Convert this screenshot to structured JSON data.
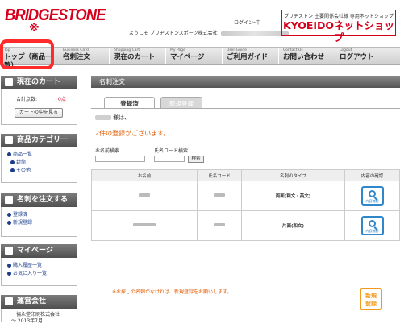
{
  "header": {
    "logo": "BRIDGESTONE",
    "logo_mark": "※",
    "login_label": "ログインｰ中",
    "welcome_prefix": "ようこそ ブリヂストンスポーツ株式会社",
    "shop_subtitle": "ブリヂストン 主要関係会社様 専用ネットショップ",
    "shop_name": "KYOEIDOネットショップ"
  },
  "nav": {
    "items": [
      {
        "en": "Top",
        "ja": "トップ（商品一覧）"
      },
      {
        "en": "Business Card",
        "ja": "名刺注文"
      },
      {
        "en": "Shopping Cart",
        "ja": "現在のカート"
      },
      {
        "en": "My Page",
        "ja": "マイページ"
      },
      {
        "en": "User Guide",
        "ja": "ご利用ガイド"
      },
      {
        "en": "Contact Us",
        "ja": "お問い合わせ"
      },
      {
        "en": "Logout",
        "ja": "ログアウト"
      }
    ]
  },
  "sidebar": {
    "cart": {
      "title": "現在のカート",
      "total_label": "合計点数:",
      "total_value": "0点",
      "view_button": "カートの中を見る"
    },
    "categories": {
      "title": "商品カテゴリー",
      "items": [
        "商品一覧",
        "封筒",
        "その他"
      ]
    },
    "order": {
      "title": "名刺を注文する",
      "items": [
        "登録済",
        "新規登録"
      ]
    },
    "mypage": {
      "title": "マイページ",
      "items": [
        "購入履歴一覧",
        "お気に入り一覧"
      ]
    },
    "company": {
      "title": "運営会社",
      "name": "協永堂印刷株式会社",
      "date": "〜 2013年7月"
    }
  },
  "main": {
    "title": "名刺注文",
    "tab_registered": "登録済",
    "tab_new": "新規登録",
    "greeting_suffix": "様は、",
    "count_text": "2件の登録がございます。",
    "search_name_label": "お名前検索",
    "search_code_label": "氏名コード検索",
    "search_button": "検索",
    "table": {
      "headers": [
        "お名前",
        "氏名コード",
        "名刺のタイプ",
        "内容の確認"
      ],
      "rows": [
        {
          "type": "両面(和文・英文)",
          "confirm": "内容確認"
        },
        {
          "type": "片面(和文)",
          "confirm": "内容確認"
        }
      ]
    },
    "note": "※お探しの名刺がなければ、新規登録をお願いします。",
    "new_button_line1": "新規",
    "new_button_line2": "登録"
  }
}
